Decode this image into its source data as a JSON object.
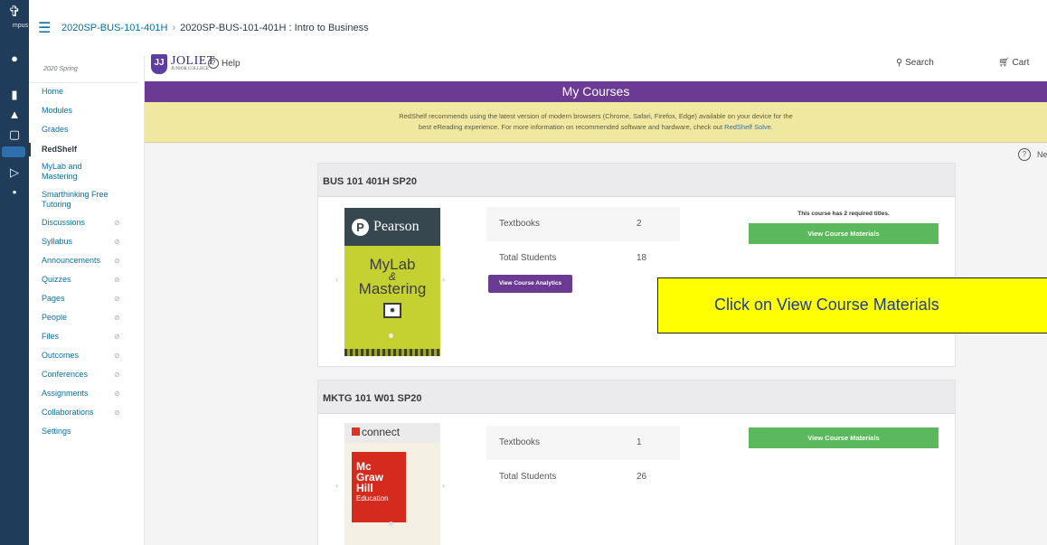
{
  "breadcrumb": {
    "course_code": "2020SP-BUS-101-401H",
    "current": "2020SP-BUS-101-401H : Intro to Business"
  },
  "global_nav": {
    "logo_text": "mpus"
  },
  "sidebar": {
    "term": "2020 Spring",
    "items": [
      {
        "label": "Home",
        "hidden": false
      },
      {
        "label": "Modules",
        "hidden": false
      },
      {
        "label": "Grades",
        "hidden": false
      },
      {
        "label": "RedShelf",
        "hidden": false,
        "active": true
      },
      {
        "label": "MyLab and Mastering",
        "hidden": false
      },
      {
        "label": "Smarthinking Free Tutoring",
        "hidden": false
      },
      {
        "label": "Discussions",
        "hidden": true
      },
      {
        "label": "Syllabus",
        "hidden": true
      },
      {
        "label": "Announcements",
        "hidden": true
      },
      {
        "label": "Quizzes",
        "hidden": true
      },
      {
        "label": "Pages",
        "hidden": true
      },
      {
        "label": "People",
        "hidden": true
      },
      {
        "label": "Files",
        "hidden": true
      },
      {
        "label": "Outcomes",
        "hidden": true
      },
      {
        "label": "Conferences",
        "hidden": true
      },
      {
        "label": "Assignments",
        "hidden": true
      },
      {
        "label": "Collaborations",
        "hidden": true
      },
      {
        "label": "Settings",
        "hidden": false
      }
    ]
  },
  "redshelf": {
    "logo_name": "JOLIET",
    "logo_sub": "JUNIOR COLLEGE",
    "help": "Help",
    "search": "Search",
    "cart": "Cart",
    "header": "My Courses",
    "notice_line1": "RedShelf recommends using the latest version of modern browsers (Chrome, Safari, Firefox, Edge) available on your device for the",
    "notice_line2": "best eReading experience. For more information on recommended software and hardware, check out",
    "notice_link": "RedShelf Solve.",
    "need_help": "Need Help?"
  },
  "courses": [
    {
      "name": "BUS 101 401H SP20",
      "textbooks_label": "Textbooks",
      "textbooks": "2",
      "students_label": "Total Students",
      "students": "18",
      "required_note": "This course has 2 required titles.",
      "materials_button": "View Course Materials",
      "analytics_button": "View Course Analytics",
      "cover": {
        "publisher": "Pearson",
        "title1": "MyLab",
        "amp": "&",
        "title2": "Mastering"
      }
    },
    {
      "name": "MKTG 101 W01 SP20",
      "textbooks_label": "Textbooks",
      "textbooks": "1",
      "students_label": "Total Students",
      "students": "26",
      "materials_button": "View Course Materials",
      "cover": {
        "brand": "connect",
        "l1": "Mc",
        "l2": "Graw",
        "l3": "Hill",
        "l4": "Education"
      }
    }
  ],
  "annotation": "Click on View Course Materials",
  "colors": {
    "purple": "#6b3b93",
    "green": "#5cb85c",
    "yellow_notice": "#f0e8a1",
    "annotation_yellow": "#ffff00",
    "link": "#0770a3"
  }
}
